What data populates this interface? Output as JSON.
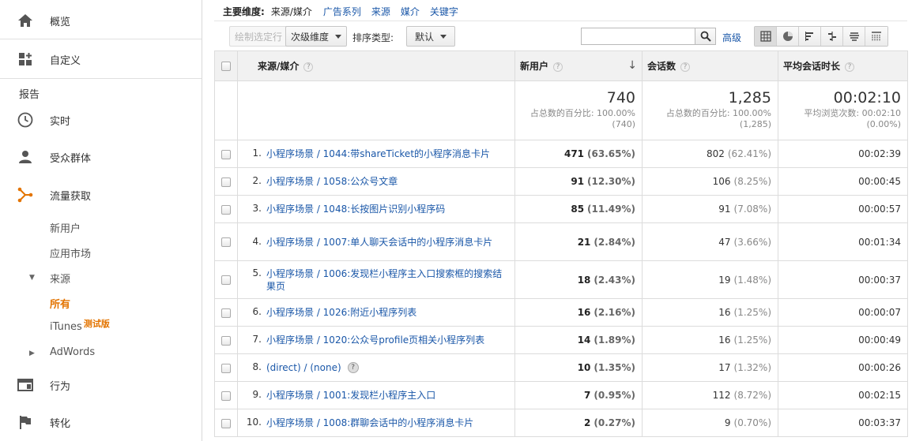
{
  "sidebar": {
    "overview": "概览",
    "customize": "自定义",
    "reports": "报告",
    "realtime": "实时",
    "audience": "受众群体",
    "acquisition": "流量获取",
    "sub": {
      "new_users": "新用户",
      "app_market": "应用市场",
      "source": "来源",
      "all": "所有",
      "itunes": "iTunes",
      "beta": "测试版",
      "adwords": "AdWords"
    },
    "behavior": "行为",
    "conversions": "转化"
  },
  "dimensions": {
    "primary_label": "主要维度:",
    "current": "来源/媒介",
    "links": [
      "广告系列",
      "来源",
      "媒介",
      "关键字"
    ]
  },
  "toolbar": {
    "plot_rows": "绘制选定行",
    "secondary_dim": "次级维度",
    "sort_type_label": "排序类型:",
    "sort_type_value": "默认",
    "search_value": "",
    "advanced": "高级"
  },
  "table": {
    "headers": {
      "source_medium": "来源/媒介",
      "new_users": "新用户",
      "sessions": "会话数",
      "avg_duration": "平均会话时长"
    },
    "totals": {
      "new_users": "740",
      "new_users_sub1": "占总数的百分比: 100.00%",
      "new_users_sub2": "(740)",
      "sessions": "1,285",
      "sessions_sub1": "占总数的百分比: 100.00%",
      "sessions_sub2": "(1,285)",
      "avg_duration": "00:02:10",
      "avg_duration_sub1": "平均浏览次数: 00:02:10",
      "avg_duration_sub2": "(0.00%)"
    },
    "rows": [
      {
        "idx": "1.",
        "source": "小程序场景 / 1044:带shareTicket的小程序消息卡片",
        "new_users": "471",
        "new_users_pct": "(63.65%)",
        "sessions": "802",
        "sessions_pct": "(62.41%)",
        "duration": "00:02:39"
      },
      {
        "idx": "2.",
        "source": "小程序场景 / 1058:公众号文章",
        "new_users": "91",
        "new_users_pct": "(12.30%)",
        "sessions": "106",
        "sessions_pct": "(8.25%)",
        "duration": "00:00:45"
      },
      {
        "idx": "3.",
        "source": "小程序场景 / 1048:长按图片识别小程序码",
        "new_users": "85",
        "new_users_pct": "(11.49%)",
        "sessions": "91",
        "sessions_pct": "(7.08%)",
        "duration": "00:00:57"
      },
      {
        "idx": "4.",
        "source": "小程序场景 / 1007:单人聊天会话中的小程序消息卡片",
        "new_users": "21",
        "new_users_pct": "(2.84%)",
        "sessions": "47",
        "sessions_pct": "(3.66%)",
        "duration": "00:01:34"
      },
      {
        "idx": "5.",
        "source": "小程序场景 / 1006:发现栏小程序主入口搜索框的搜索结果页",
        "new_users": "18",
        "new_users_pct": "(2.43%)",
        "sessions": "19",
        "sessions_pct": "(1.48%)",
        "duration": "00:00:37"
      },
      {
        "idx": "6.",
        "source": "小程序场景 / 1026:附近小程序列表",
        "new_users": "16",
        "new_users_pct": "(2.16%)",
        "sessions": "16",
        "sessions_pct": "(1.25%)",
        "duration": "00:00:07"
      },
      {
        "idx": "7.",
        "source": "小程序场景 / 1020:公众号profile页相关小程序列表",
        "new_users": "14",
        "new_users_pct": "(1.89%)",
        "sessions": "16",
        "sessions_pct": "(1.25%)",
        "duration": "00:00:49"
      },
      {
        "idx": "8.",
        "source": "(direct) / (none)",
        "new_users": "10",
        "new_users_pct": "(1.35%)",
        "sessions": "17",
        "sessions_pct": "(1.32%)",
        "duration": "00:00:26"
      },
      {
        "idx": "9.",
        "source": "小程序场景 / 1001:发现栏小程序主入口",
        "new_users": "7",
        "new_users_pct": "(0.95%)",
        "sessions": "112",
        "sessions_pct": "(8.72%)",
        "duration": "00:02:15"
      },
      {
        "idx": "10.",
        "source": "小程序场景 / 1008:群聊会话中的小程序消息卡片",
        "new_users": "2",
        "new_users_pct": "(0.27%)",
        "sessions": "9",
        "sessions_pct": "(0.70%)",
        "duration": "00:03:37"
      }
    ]
  },
  "colors": {
    "accent": "#e37400",
    "link": "#1a57a8"
  }
}
